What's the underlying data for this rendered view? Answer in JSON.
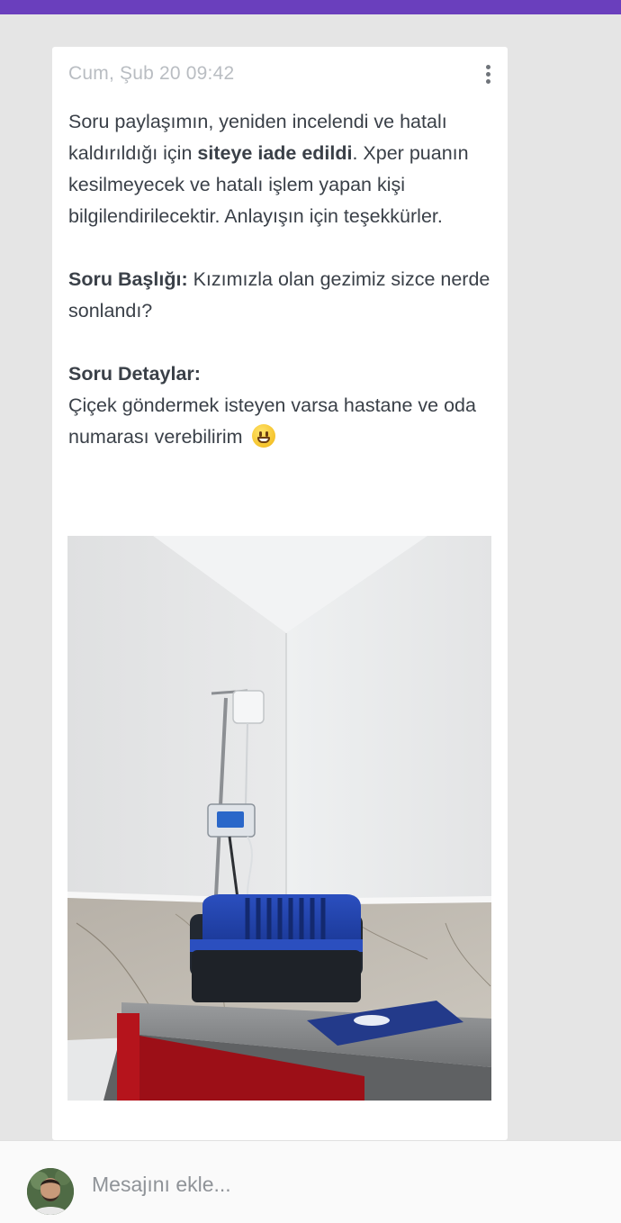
{
  "colors": {
    "header_accent": "#6a3fbd",
    "background": "#e5e5e5",
    "card": "#ffffff",
    "timestamp": "#b9bdc2",
    "text": "#3a4048"
  },
  "message": {
    "timestamp": "Cum, Şub 20 09:42",
    "menu_icon": "more-vertical-icon",
    "intro_before_bold": "Soru paylaşımın, yeniden incelendi ve hatalı kaldırıldığı için ",
    "intro_bold": "siteye iade edildi",
    "intro_after_bold": ". Xper puanın kesilmeyecek ve hatalı işlem yapan kişi bilgilendirilecektir. Anlayışın için teşekkürler.",
    "title_label": "Soru Başlığı:",
    "title_value": " Kızımızla olan gezimiz sizce nerde sonlandı?",
    "details_label": "Soru Detaylar:",
    "details_value": "Çiçek göndermek isteyen varsa hastane ve oda numarası verebilirim",
    "details_emoji": "grinning-face-emoji",
    "attachment_icon": "photo-attachment"
  },
  "composer": {
    "avatar_icon": "user-avatar",
    "placeholder": "Mesajını ekle..."
  }
}
